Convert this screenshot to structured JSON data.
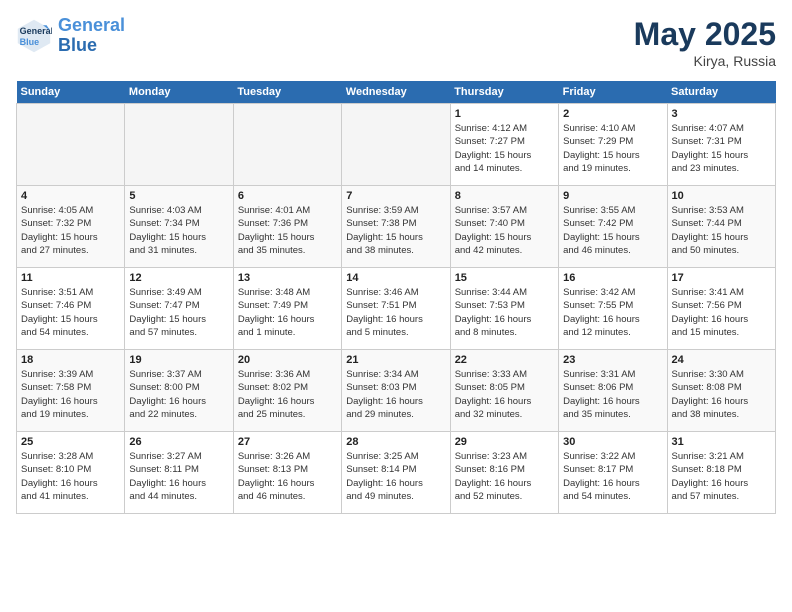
{
  "header": {
    "logo_line1": "General",
    "logo_line2": "Blue",
    "month": "May 2025",
    "location": "Kirya, Russia"
  },
  "weekdays": [
    "Sunday",
    "Monday",
    "Tuesday",
    "Wednesday",
    "Thursday",
    "Friday",
    "Saturday"
  ],
  "weeks": [
    [
      {
        "day": "",
        "info": ""
      },
      {
        "day": "",
        "info": ""
      },
      {
        "day": "",
        "info": ""
      },
      {
        "day": "",
        "info": ""
      },
      {
        "day": "1",
        "info": "Sunrise: 4:12 AM\nSunset: 7:27 PM\nDaylight: 15 hours\nand 14 minutes."
      },
      {
        "day": "2",
        "info": "Sunrise: 4:10 AM\nSunset: 7:29 PM\nDaylight: 15 hours\nand 19 minutes."
      },
      {
        "day": "3",
        "info": "Sunrise: 4:07 AM\nSunset: 7:31 PM\nDaylight: 15 hours\nand 23 minutes."
      }
    ],
    [
      {
        "day": "4",
        "info": "Sunrise: 4:05 AM\nSunset: 7:32 PM\nDaylight: 15 hours\nand 27 minutes."
      },
      {
        "day": "5",
        "info": "Sunrise: 4:03 AM\nSunset: 7:34 PM\nDaylight: 15 hours\nand 31 minutes."
      },
      {
        "day": "6",
        "info": "Sunrise: 4:01 AM\nSunset: 7:36 PM\nDaylight: 15 hours\nand 35 minutes."
      },
      {
        "day": "7",
        "info": "Sunrise: 3:59 AM\nSunset: 7:38 PM\nDaylight: 15 hours\nand 38 minutes."
      },
      {
        "day": "8",
        "info": "Sunrise: 3:57 AM\nSunset: 7:40 PM\nDaylight: 15 hours\nand 42 minutes."
      },
      {
        "day": "9",
        "info": "Sunrise: 3:55 AM\nSunset: 7:42 PM\nDaylight: 15 hours\nand 46 minutes."
      },
      {
        "day": "10",
        "info": "Sunrise: 3:53 AM\nSunset: 7:44 PM\nDaylight: 15 hours\nand 50 minutes."
      }
    ],
    [
      {
        "day": "11",
        "info": "Sunrise: 3:51 AM\nSunset: 7:46 PM\nDaylight: 15 hours\nand 54 minutes."
      },
      {
        "day": "12",
        "info": "Sunrise: 3:49 AM\nSunset: 7:47 PM\nDaylight: 15 hours\nand 57 minutes."
      },
      {
        "day": "13",
        "info": "Sunrise: 3:48 AM\nSunset: 7:49 PM\nDaylight: 16 hours\nand 1 minute."
      },
      {
        "day": "14",
        "info": "Sunrise: 3:46 AM\nSunset: 7:51 PM\nDaylight: 16 hours\nand 5 minutes."
      },
      {
        "day": "15",
        "info": "Sunrise: 3:44 AM\nSunset: 7:53 PM\nDaylight: 16 hours\nand 8 minutes."
      },
      {
        "day": "16",
        "info": "Sunrise: 3:42 AM\nSunset: 7:55 PM\nDaylight: 16 hours\nand 12 minutes."
      },
      {
        "day": "17",
        "info": "Sunrise: 3:41 AM\nSunset: 7:56 PM\nDaylight: 16 hours\nand 15 minutes."
      }
    ],
    [
      {
        "day": "18",
        "info": "Sunrise: 3:39 AM\nSunset: 7:58 PM\nDaylight: 16 hours\nand 19 minutes."
      },
      {
        "day": "19",
        "info": "Sunrise: 3:37 AM\nSunset: 8:00 PM\nDaylight: 16 hours\nand 22 minutes."
      },
      {
        "day": "20",
        "info": "Sunrise: 3:36 AM\nSunset: 8:02 PM\nDaylight: 16 hours\nand 25 minutes."
      },
      {
        "day": "21",
        "info": "Sunrise: 3:34 AM\nSunset: 8:03 PM\nDaylight: 16 hours\nand 29 minutes."
      },
      {
        "day": "22",
        "info": "Sunrise: 3:33 AM\nSunset: 8:05 PM\nDaylight: 16 hours\nand 32 minutes."
      },
      {
        "day": "23",
        "info": "Sunrise: 3:31 AM\nSunset: 8:06 PM\nDaylight: 16 hours\nand 35 minutes."
      },
      {
        "day": "24",
        "info": "Sunrise: 3:30 AM\nSunset: 8:08 PM\nDaylight: 16 hours\nand 38 minutes."
      }
    ],
    [
      {
        "day": "25",
        "info": "Sunrise: 3:28 AM\nSunset: 8:10 PM\nDaylight: 16 hours\nand 41 minutes."
      },
      {
        "day": "26",
        "info": "Sunrise: 3:27 AM\nSunset: 8:11 PM\nDaylight: 16 hours\nand 44 minutes."
      },
      {
        "day": "27",
        "info": "Sunrise: 3:26 AM\nSunset: 8:13 PM\nDaylight: 16 hours\nand 46 minutes."
      },
      {
        "day": "28",
        "info": "Sunrise: 3:25 AM\nSunset: 8:14 PM\nDaylight: 16 hours\nand 49 minutes."
      },
      {
        "day": "29",
        "info": "Sunrise: 3:23 AM\nSunset: 8:16 PM\nDaylight: 16 hours\nand 52 minutes."
      },
      {
        "day": "30",
        "info": "Sunrise: 3:22 AM\nSunset: 8:17 PM\nDaylight: 16 hours\nand 54 minutes."
      },
      {
        "day": "31",
        "info": "Sunrise: 3:21 AM\nSunset: 8:18 PM\nDaylight: 16 hours\nand 57 minutes."
      }
    ]
  ]
}
